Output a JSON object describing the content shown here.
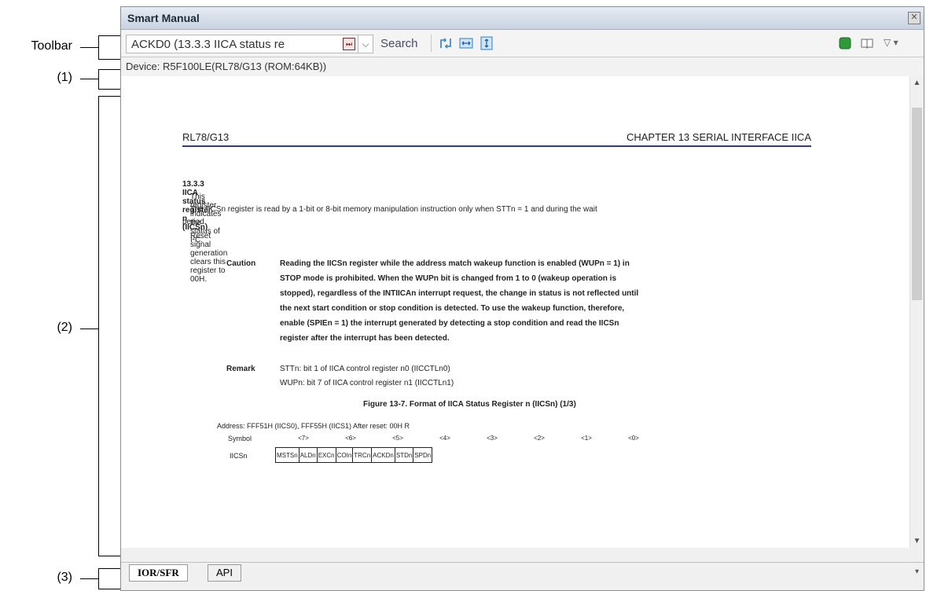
{
  "callouts": {
    "toolbar": "Toolbar",
    "c1": "(1)",
    "c2": "(2)",
    "c3": "(3)"
  },
  "window": {
    "title": "Smart Manual",
    "close_glyph": "✕"
  },
  "toolbar": {
    "dropdown_value": "ACKD0 (13.3.3  IICA status re",
    "forward_glyph": "⏭",
    "chevron_glyph": "⌵",
    "search_label": "Search",
    "right_dropdown_glyph": "▽ ▾"
  },
  "device": {
    "label": "Device: R5F100LE(RL78/G13 (ROM:64KB))"
  },
  "document": {
    "header_left": "RL78/G13",
    "header_right": "CHAPTER  13   SERIAL INTERFACE IICA",
    "section_title": "13.3.3  IICA status register n (IICSn)",
    "para1": "This register indicates the status of I²C.",
    "para2a": "The IICSn register is read by a 1-bit or 8-bit memory manipulation instruction only when STTn = 1 and during the wait",
    "para2b": "period.",
    "para3": "Reset signal generation clears this register to 00H.",
    "caution_label": "Caution",
    "caution_lines": [
      "Reading the IICSn register while the address match wakeup function is enabled (WUPn = 1) in",
      "STOP mode is prohibited.  When the WUPn bit is changed from 1 to 0 (wakeup operation is",
      "stopped), regardless of the INTIICAn interrupt request, the change in status is not reflected until",
      "the next start condition or stop condition is detected.  To use the wakeup function, therefore,",
      "enable (SPIEn = 1) the interrupt generated by detecting a stop condition and read the IICSn",
      "register after the interrupt has been detected."
    ],
    "remark_label": "Remark",
    "remark_lines": [
      "STTn:   bit 1 of IICA control register n0 (IICCTLn0)",
      "WUPn:  bit 7 of IICA control register n1 (IICCTLn1)"
    ],
    "figure_title": "Figure 13-7.  Format of IICA Status Register n (IICSn) (1/3)",
    "address_line": "Address:  FFF51H (IICS0), FFF55H (IICS1)     After reset: 00H    R",
    "symbol_label": "Symbol",
    "reg_name": "IICSn",
    "bit_positions": [
      "<7>",
      "<6>",
      "<5>",
      "<4>",
      "<3>",
      "<2>",
      "<1>",
      "<0>"
    ],
    "bits": [
      "MSTSn",
      "ALDn",
      "EXCn",
      "COIn",
      "TRCn",
      "ACKDn",
      "STDn",
      "SPDn"
    ]
  },
  "tabs": [
    {
      "label": "IOR/SFR"
    },
    {
      "label": "API"
    }
  ],
  "tab_menu_glyph": "▾",
  "colors": {
    "header_rule": "#2e3b8f",
    "title_bar": "#c8d2e0"
  }
}
